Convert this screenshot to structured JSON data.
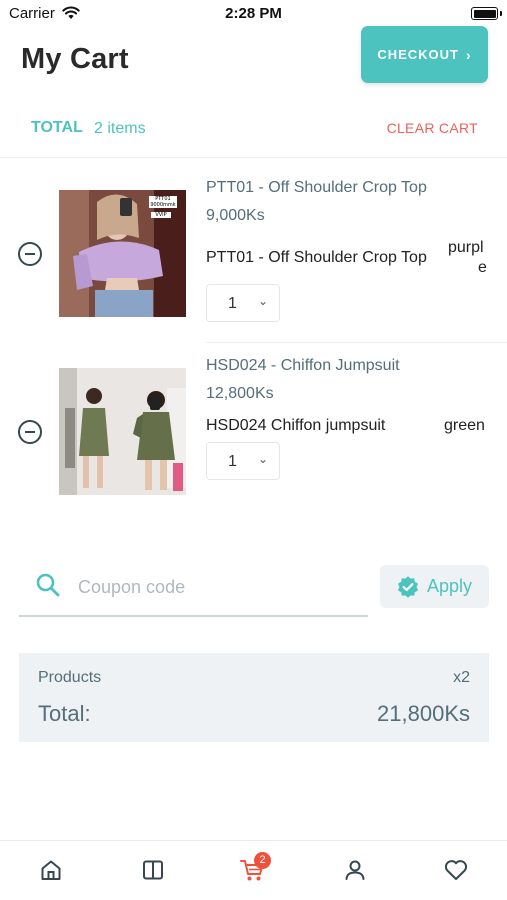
{
  "status_bar": {
    "carrier": "Carrier",
    "time": "2:28 PM"
  },
  "header": {
    "title": "My Cart",
    "checkout_label": "CHECKOUT"
  },
  "cart_summary": {
    "total_label": "TOTAL",
    "item_count": "2 items",
    "clear_label": "CLEAR CART"
  },
  "items": [
    {
      "name": "PTT01 - Off Shoulder Crop Top",
      "price": "9,000Ks",
      "variant": "PTT01 - Off Shoulder Crop Top",
      "color_line1": "purpl",
      "color_line2": "e",
      "quantity": "1",
      "tag_lines": [
        "PTT01",
        "9000mmk",
        "VVIP"
      ]
    },
    {
      "name": "HSD024 - Chiffon Jumpsuit",
      "price": "12,800Ks",
      "variant": "HSD024 Chiffon jumpsuit",
      "color": "green",
      "quantity": "1"
    }
  ],
  "coupon": {
    "placeholder": "Coupon code",
    "apply_label": "Apply"
  },
  "summary": {
    "products_label": "Products",
    "products_qty": "x2",
    "total_label": "Total:",
    "total_value": "21,800Ks"
  },
  "nav": {
    "cart_badge": "2",
    "items": [
      "home-icon",
      "catalog-icon",
      "cart-icon",
      "profile-icon",
      "favorites-icon"
    ]
  },
  "colors": {
    "accent": "#4dc3c0",
    "danger": "#f0605a",
    "text_muted": "#546e7a",
    "badge": "#f0503c"
  }
}
